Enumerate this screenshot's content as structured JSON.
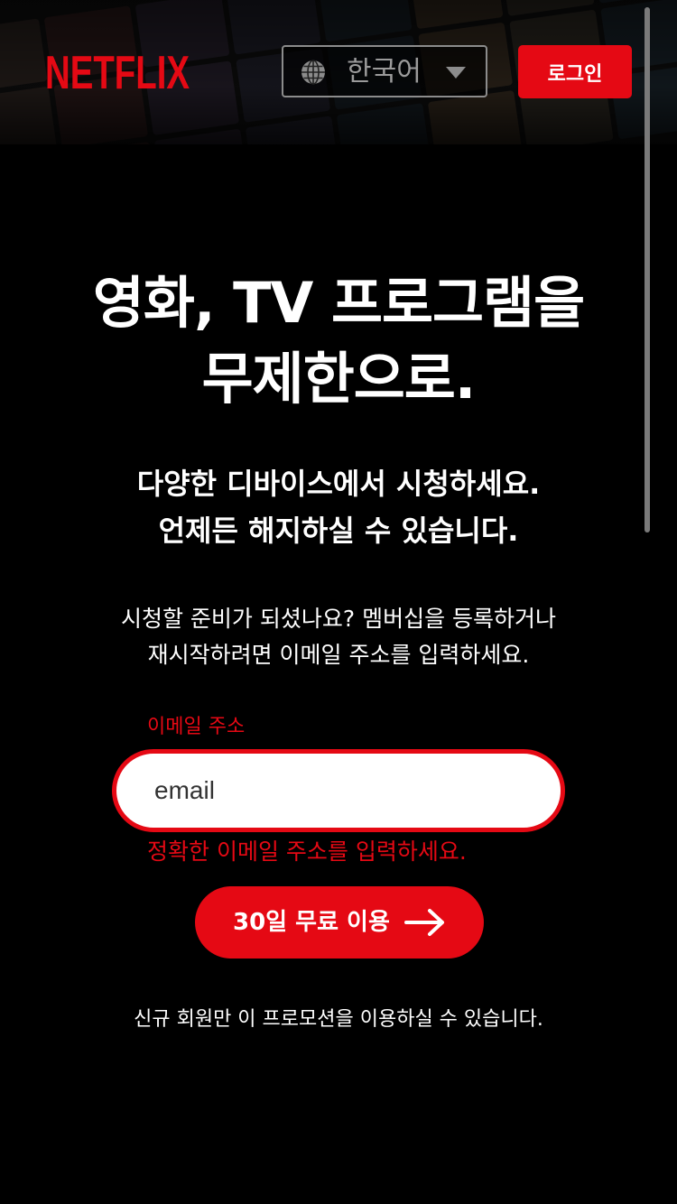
{
  "header": {
    "logo_text": "NETFLIX",
    "language": {
      "selected": "한국어",
      "icon": "globe-icon"
    },
    "login_label": "로그인"
  },
  "hero": {
    "title_lines": [
      "영화, TV 프로그램을",
      "무제한으로."
    ],
    "subtitle_lines": [
      "다양한 디바이스에서 시청하세요.",
      "언제든 해지하실 수 있습니다."
    ],
    "cta_lines": [
      "시청할 준비가 되셨나요? 멤버십을 등록하거나",
      "재시작하려면 이메일 주소를 입력하세요."
    ]
  },
  "form": {
    "email_label": "이메일 주소",
    "email_value": "email",
    "error_text": "정확한 이메일 주소를 입력하세요.",
    "submit_label": "30일 무료 이용",
    "submit_icon": "arrow-right-icon"
  },
  "promo_note": "신규 회원만 이 프로모션을 이용하실 수 있습니다.",
  "colors": {
    "brand_red": "#e50914",
    "background": "#000000",
    "border_gray": "#8c8c8c"
  }
}
